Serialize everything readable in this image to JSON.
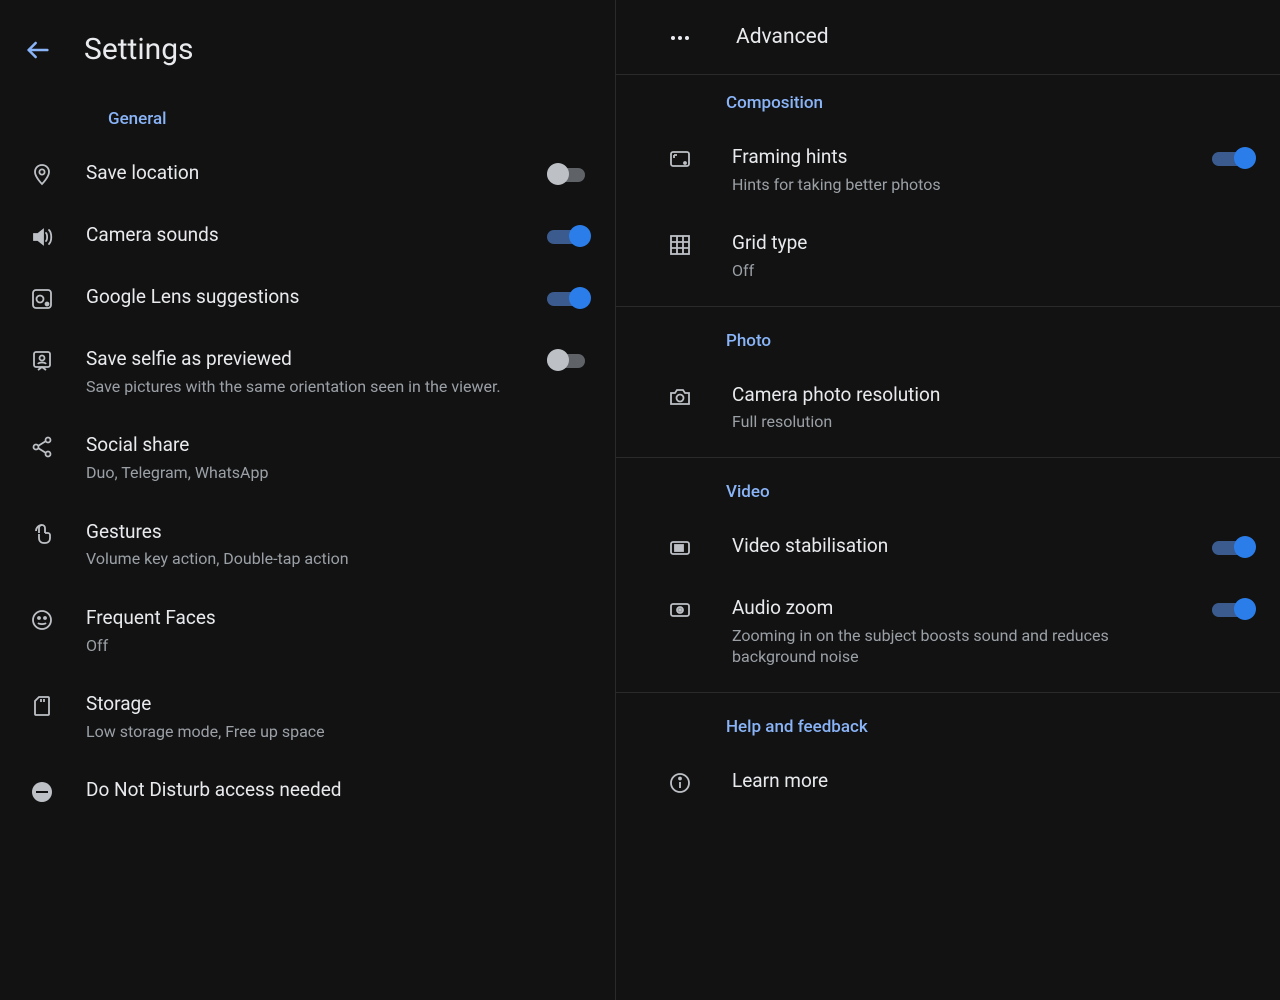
{
  "left": {
    "title": "Settings",
    "section": "General",
    "items": [
      {
        "key": "save-location",
        "title": "Save location",
        "toggle": "off"
      },
      {
        "key": "camera-sounds",
        "title": "Camera sounds",
        "toggle": "on"
      },
      {
        "key": "google-lens",
        "title": "Google Lens suggestions",
        "toggle": "on"
      },
      {
        "key": "save-selfie",
        "title": "Save selfie as previewed",
        "sub": "Save pictures with the same orientation seen in the viewer.",
        "toggle": "off"
      },
      {
        "key": "social-share",
        "title": "Social share",
        "sub": "Duo, Telegram, WhatsApp"
      },
      {
        "key": "gestures",
        "title": "Gestures",
        "sub": "Volume key action, Double-tap action"
      },
      {
        "key": "frequent-faces",
        "title": "Frequent Faces",
        "sub": "Off"
      },
      {
        "key": "storage",
        "title": "Storage",
        "sub": "Low storage mode, Free up space"
      },
      {
        "key": "dnd",
        "title": "Do Not Disturb access needed"
      }
    ]
  },
  "right": {
    "advanced": "Advanced",
    "sections": {
      "composition": {
        "label": "Composition",
        "framing": {
          "title": "Framing hints",
          "sub": "Hints for taking better photos",
          "toggle": "on"
        },
        "grid": {
          "title": "Grid type",
          "sub": "Off"
        }
      },
      "photo": {
        "label": "Photo",
        "resolution": {
          "title": "Camera photo resolution",
          "sub": "Full resolution"
        }
      },
      "video": {
        "label": "Video",
        "stab": {
          "title": "Video stabilisation",
          "toggle": "on"
        },
        "audio": {
          "title": "Audio zoom",
          "sub": "Zooming in on the subject boosts sound and reduces background noise",
          "toggle": "on"
        }
      },
      "help": {
        "label": "Help and feedback",
        "learn": {
          "title": "Learn more"
        }
      }
    }
  }
}
